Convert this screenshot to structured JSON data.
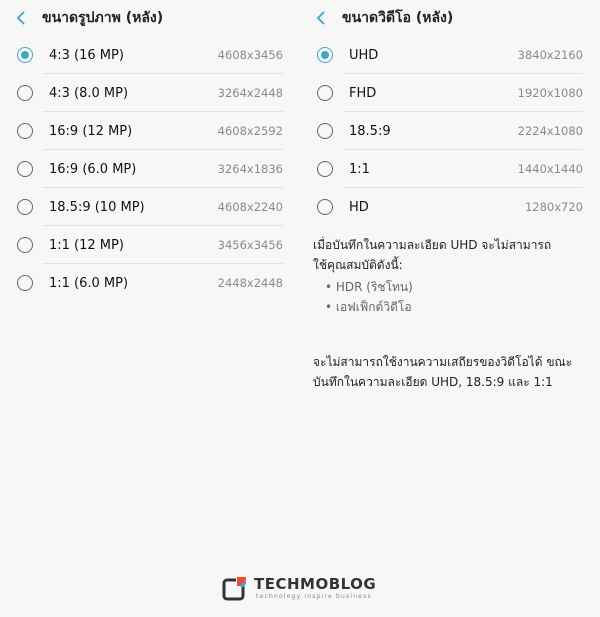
{
  "photo": {
    "title": "ขนาดรูปภาพ (หลัง)",
    "options": [
      {
        "label": "4:3 (16 MP)",
        "res": "4608x3456",
        "selected": true
      },
      {
        "label": "4:3 (8.0 MP)",
        "res": "3264x2448",
        "selected": false
      },
      {
        "label": "16:9 (12 MP)",
        "res": "4608x2592",
        "selected": false
      },
      {
        "label": "16:9 (6.0 MP)",
        "res": "3264x1836",
        "selected": false
      },
      {
        "label": "18.5:9 (10 MP)",
        "res": "4608x2240",
        "selected": false
      },
      {
        "label": "1:1 (12 MP)",
        "res": "3456x3456",
        "selected": false
      },
      {
        "label": "1:1 (6.0 MP)",
        "res": "2448x2448",
        "selected": false
      }
    ]
  },
  "video": {
    "title": "ขนาดวิดีโอ (หลัง)",
    "options": [
      {
        "label": "UHD",
        "res": "3840x2160",
        "selected": true
      },
      {
        "label": "FHD",
        "res": "1920x1080",
        "selected": false
      },
      {
        "label": "18.5:9",
        "res": "2224x1080",
        "selected": false
      },
      {
        "label": "1:1",
        "res": "1440x1440",
        "selected": false
      },
      {
        "label": "HD",
        "res": "1280x720",
        "selected": false
      }
    ],
    "note1_line1": "เมื่อบันทึกในความละเอียด UHD จะไม่สามารถ",
    "note1_line2": "ใช้คุณสมบัติดังนี้:",
    "bullets": [
      "• HDR (ริชโทน)",
      "• เอฟเฟ็กต์วิดีโอ"
    ],
    "note2_line1": "จะไม่สามารถใช้งานความเสถียรของวิดีโอได้ ขณะ",
    "note2_line2": "บันทึกในความละเอียด UHD, 18.5:9 และ 1:1"
  },
  "watermark": {
    "word": "TECHMOBLOG",
    "tagline": "technology inspire business"
  },
  "colors": {
    "accent": "#3ea7c4",
    "background": "#f7f7f7"
  },
  "icons": {
    "back": "chevron-left-icon",
    "radio": "radio-button-icon"
  }
}
